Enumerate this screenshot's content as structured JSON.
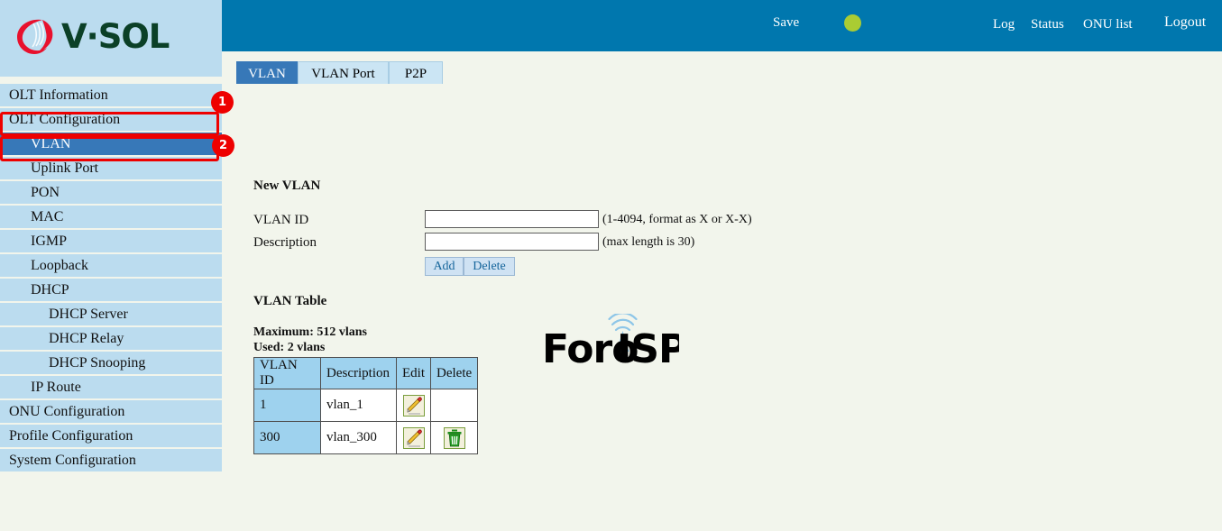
{
  "brand": {
    "logo_text": "V·SOL",
    "logo_icon": "vsol-swirl-logo",
    "logo_mark_color": "#e8112d",
    "logo_text_color": "#0b4027"
  },
  "topbar": {
    "background_color": "#0077ae",
    "save_label": "Save",
    "save_indicator_icon": "status-dot-icon",
    "save_indicator_color": "#aacc33",
    "links": [
      {
        "label": "Log",
        "name": "log"
      },
      {
        "label": "Status",
        "name": "status"
      },
      {
        "label": "ONU list",
        "name": "onu-list"
      },
      {
        "label": "Logout",
        "name": "logout"
      }
    ]
  },
  "tabs": {
    "active_index": 0,
    "active_color": "#3778b8",
    "inactive_color": "#cbe5f4",
    "items": [
      {
        "label": "VLAN"
      },
      {
        "label": "VLAN Port"
      },
      {
        "label": "P2P"
      }
    ]
  },
  "sidebar": {
    "background_color": "#bbdcef",
    "selected_color": "#3778b8",
    "items": [
      {
        "label": "OLT Information",
        "level": 0,
        "selected": false
      },
      {
        "label": "OLT Configuration",
        "level": 0,
        "selected": false
      },
      {
        "label": "VLAN",
        "level": 1,
        "selected": true
      },
      {
        "label": "Uplink Port",
        "level": 1,
        "selected": false
      },
      {
        "label": "PON",
        "level": 1,
        "selected": false
      },
      {
        "label": "MAC",
        "level": 1,
        "selected": false
      },
      {
        "label": "IGMP",
        "level": 1,
        "selected": false
      },
      {
        "label": "Loopback",
        "level": 1,
        "selected": false
      },
      {
        "label": "DHCP",
        "level": 1,
        "selected": false
      },
      {
        "label": "DHCP Server",
        "level": 2,
        "selected": false
      },
      {
        "label": "DHCP Relay",
        "level": 2,
        "selected": false
      },
      {
        "label": "DHCP Snooping",
        "level": 2,
        "selected": false
      },
      {
        "label": "IP Route",
        "level": 1,
        "selected": false
      },
      {
        "label": "ONU Configuration",
        "level": 0,
        "selected": false
      },
      {
        "label": "Profile Configuration",
        "level": 0,
        "selected": false
      },
      {
        "label": "System Configuration",
        "level": 0,
        "selected": false
      }
    ]
  },
  "annotations": {
    "color": "#ee0000",
    "badges": [
      {
        "number": "1",
        "target": "OLT Configuration"
      },
      {
        "number": "2",
        "target": "VLAN"
      }
    ]
  },
  "main": {
    "new_vlan": {
      "title": "New VLAN",
      "vlan_id_label": "VLAN ID",
      "vlan_id_value": "",
      "vlan_id_hint": "(1-4094, format as X or X-X)",
      "description_label": "Description",
      "description_value": "",
      "description_hint": "(max length is 30)",
      "add_label": "Add",
      "delete_label": "Delete"
    },
    "vlan_table": {
      "title": "VLAN Table",
      "maximum_text": "Maximum: 512 vlans",
      "used_text": "Used: 2 vlans",
      "columns": [
        "VLAN ID",
        "Description",
        "Edit",
        "Delete"
      ],
      "rows": [
        {
          "vlan_id": "1",
          "description": "vlan_1",
          "edit_icon": "pencil-edit-icon",
          "delete_icon": null
        },
        {
          "vlan_id": "300",
          "description": "vlan_300",
          "edit_icon": "pencil-edit-icon",
          "delete_icon": "trash-delete-icon"
        }
      ]
    }
  },
  "watermark": {
    "text_part1": "Foro",
    "text_part2": "ISP",
    "icon": "antenna-tower-icon",
    "color1": "#7d7d7d",
    "color2": "#8ec6e8"
  }
}
